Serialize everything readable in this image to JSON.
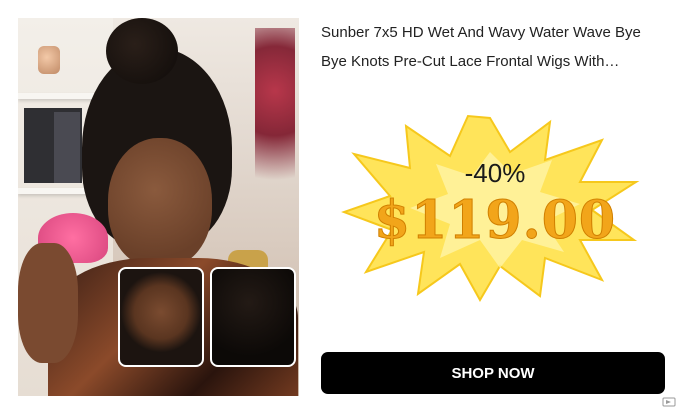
{
  "product": {
    "title": "Sunber 7x5 HD Wet And Wavy Water Wave Bye Bye Knots Pre-Cut Lace Frontal Wigs With…",
    "discount": "-40%",
    "price": "$119.00"
  },
  "cta": {
    "label": "SHOP NOW"
  },
  "colors": {
    "price": "#f2a51a",
    "burst": "#ffe45a",
    "button": "#000000"
  },
  "icons": {
    "ad_badge": "ad-choices-icon"
  }
}
